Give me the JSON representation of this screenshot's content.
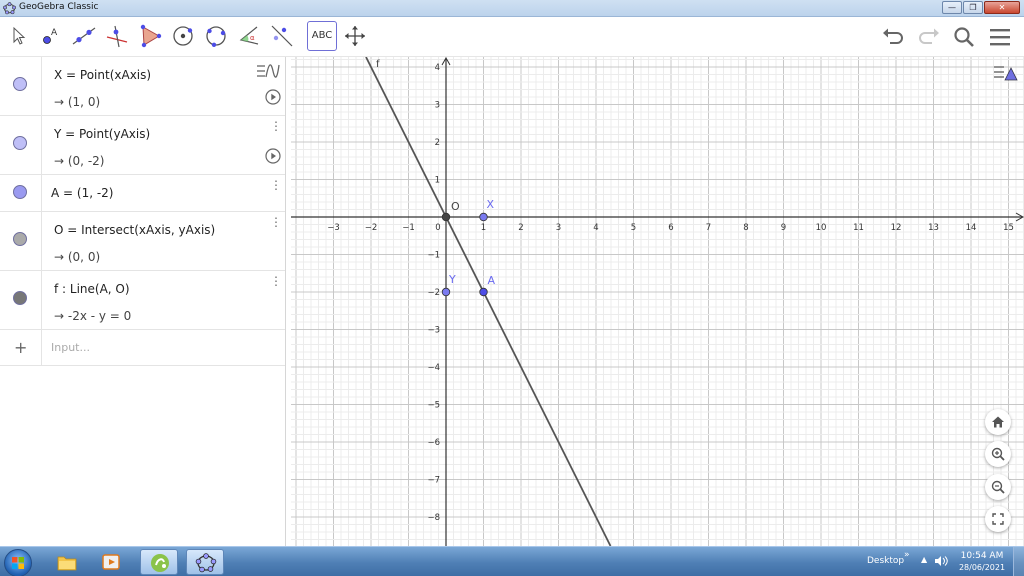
{
  "window": {
    "title": "GeoGebra Classic"
  },
  "toolbar": {
    "tools": [
      {
        "name": "move-tool"
      },
      {
        "name": "point-tool"
      },
      {
        "name": "line-tool"
      },
      {
        "name": "perpendicular-line-tool"
      },
      {
        "name": "polygon-tool"
      },
      {
        "name": "circle-center-point-tool"
      },
      {
        "name": "circle-three-points-tool"
      },
      {
        "name": "angle-tool"
      },
      {
        "name": "reflect-tool"
      },
      {
        "name": "text-tool",
        "label": "ABC",
        "active": true
      },
      {
        "name": "move-graphics-view-tool"
      }
    ],
    "right_icons": [
      "undo-icon",
      "redo-icon",
      "search-icon",
      "menu-icon"
    ]
  },
  "algebra": {
    "items": [
      {
        "definition": "X = Point(xAxis)",
        "value": "→  (1, 0)",
        "color": "#bfbff7"
      },
      {
        "definition": "Y = Point(yAxis)",
        "value": "→  (0, -2)",
        "color": "#bfbff7"
      },
      {
        "definition": "A = (1, -2)",
        "value": "",
        "color": "#9a9af0"
      },
      {
        "definition": "O = Intersect(xAxis, yAxis)",
        "value": "→  (0, 0)",
        "color": "#aaaaaa"
      },
      {
        "definition": "f : Line(A, O)",
        "value": "→  -2x - y = 0",
        "color": "#777777"
      }
    ],
    "input_placeholder": "Input..."
  },
  "graphics": {
    "x_ticks": [
      "−3",
      "−2",
      "−1",
      "0",
      "1",
      "2",
      "3",
      "4",
      "5",
      "6",
      "7",
      "8",
      "9",
      "10",
      "11",
      "12",
      "13",
      "14",
      "15"
    ],
    "y_ticks_pos": [
      "4",
      "3",
      "2",
      "1"
    ],
    "y_ticks_neg": [
      "−1",
      "−2",
      "−3",
      "−4",
      "−5",
      "−6",
      "−7",
      "−8"
    ],
    "points": [
      {
        "label": "O",
        "x": 0,
        "y": 0,
        "fill": "#444444"
      },
      {
        "label": "X",
        "x": 1,
        "y": 0,
        "fill": "#7b7bf0"
      },
      {
        "label": "Y",
        "x": 0,
        "y": -2,
        "fill": "#7b7bf0"
      },
      {
        "label": "A",
        "x": 1,
        "y": -2,
        "fill": "#4d4de6"
      }
    ],
    "line_label": "f",
    "nav_buttons": [
      "home-icon",
      "zoom-in-icon",
      "zoom-out-icon",
      "fullscreen-icon"
    ]
  },
  "taskbar": {
    "desktop_label": "Desktop",
    "chevron": "»",
    "tray_arrow": "▲",
    "time": "10:54 AM",
    "date": "28/06/2021"
  }
}
